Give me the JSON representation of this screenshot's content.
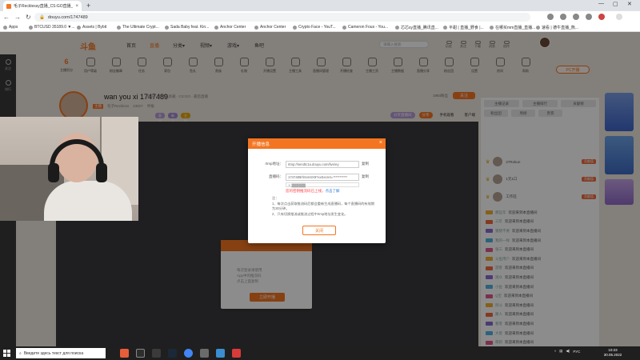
{
  "browser": {
    "tab_title": "毛子Recklessy直播_CS:GO直播_CS...",
    "url": "douyu.com/1747489",
    "bookmarks": [
      "Apps",
      "BTCUSD 35189.0 ▼...",
      "Assets | Bybit",
      "The Ultimate Crypt...",
      "Sada Baby feat. Kin...",
      "Anchor Center",
      "Anchor Center",
      "Crypto Face - YouT...",
      "Cameron Fous - You...",
      "芯芯sy直播_腾讯直...",
      "平甜 | 直播_野食 |...",
      "在哪买mm直播_直播...",
      "速看 | 德牛直播_熊..."
    ]
  },
  "site": {
    "logo": "斗鱼",
    "nav": [
      "首页",
      "直播",
      "分类▾",
      "视频▾",
      "游戏▾",
      "鱼吧"
    ],
    "search_placeholder": "请输入搜索",
    "top_icons": [
      "历史",
      "关注",
      "下载",
      "消息",
      "创作"
    ],
    "left_rail": [
      "关注",
      "排行"
    ]
  },
  "toolbar": {
    "first_value": "6",
    "first_label": "主播积分",
    "items": [
      "用户等级",
      "粉丝徽章",
      "任务",
      "背包",
      "鱼丸",
      "贵族",
      "礼物",
      "开播设置",
      "主播工具",
      "直播间管理",
      "开播检查",
      "主播工资",
      "主播数据",
      "直播分享",
      "粉丝团",
      "设置",
      "房间",
      "帮助"
    ],
    "pc_button": "PC开播"
  },
  "streamer": {
    "name": "wan you xi 1747489",
    "meta": "房间 · 主播工具箱 · CS:GO · 最后直播",
    "tag": "主播",
    "handle": "毛子Reckless",
    "heat": "23827",
    "report": "举报",
    "fans": "1993粉丝",
    "follow": "关注",
    "pills": [
      "直播间活动",
      "新手福利",
      "主播招募"
    ]
  },
  "actions": {
    "items": [
      "分享直播间",
      "分享",
      "手机观看",
      "客户端",
      "举报"
    ]
  },
  "right_panel": {
    "tabs": [
      "主播记录",
      "主播排行",
      "贡献榜",
      "粉丝团",
      "周榜",
      "贵宾"
    ],
    "ranks": [
      {
        "name": "27Rokun",
        "level": "贡献值"
      },
      {
        "name": "1元1口",
        "level": "贡献值"
      },
      {
        "name": "工作狂",
        "level": "贡献值"
      }
    ],
    "chat": [
      {
        "user": "那些年",
        "msg": "欢迎来到本直播间"
      },
      {
        "user": "三年",
        "msg": "欢迎来到本直播间"
      },
      {
        "user": "猪猪不要",
        "msg": "欢迎来到本直播间"
      },
      {
        "user": "我的一样",
        "msg": "欢迎来到本直播间"
      },
      {
        "user": "张三",
        "msg": "欢迎来到本直播间"
      },
      {
        "user": "斗鱼用户",
        "msg": "欢迎来到本直播间"
      },
      {
        "user": "游客",
        "msg": "欢迎来到本直播间"
      },
      {
        "user": "观众",
        "msg": "欢迎来到本直播间"
      },
      {
        "user": "小鱼",
        "msg": "欢迎来到本直播间"
      },
      {
        "user": "Q宝",
        "msg": "欢迎来到本直播间"
      },
      {
        "user": "阿斗",
        "msg": "欢迎来到本直播间"
      },
      {
        "user": "路人",
        "msg": "欢迎来到本直播间"
      },
      {
        "user": "看客",
        "msg": "欢迎来到本直播间"
      },
      {
        "user": "大佬",
        "msg": "欢迎来到本直播间"
      },
      {
        "user": "萌新",
        "msg": "欢迎来到本直播间"
      }
    ]
  },
  "sub_dialog": {
    "line1": "每次登录请使用",
    "line2": "App中的推流码",
    "line3": "点击上面复制",
    "button": "立即开播"
  },
  "modal": {
    "title": "开播信息",
    "rtmp_label": "rtmp地址：",
    "rtmp_value": "rtmp://sendtc1a.douyu.com/live/ey",
    "copy": "复制",
    "key_label": "直播码：",
    "key_value": "1747489rhSvnSX9?xxSecret=***********",
    "select": "✕   ▓▓▓▓▓▓",
    "warn_red": "您的密钥推流码已上线，",
    "warn_link": "点击了解",
    "notes_title": "注：",
    "notes": [
      "1、每次点击获取推流码后都会重新生成直播码，每个直播码的有效期为30分钟。",
      "2、只有切换推流或推流过程中rtmp地址发生变化。"
    ],
    "confirm": "关闭"
  },
  "taskbar": {
    "search_placeholder": "Введите здесь текст для поиска",
    "lang": "РУС",
    "time": "10:23",
    "date": "30.05.2022"
  },
  "colors": {
    "accent": "#f47521",
    "page_bg": "#efe7df",
    "player_bg": "#3a3a3c"
  }
}
